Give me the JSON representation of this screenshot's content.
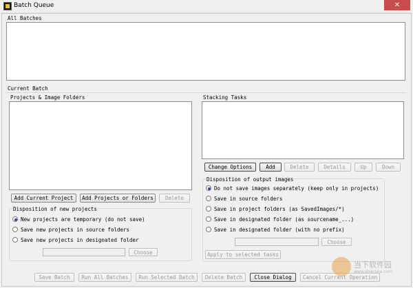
{
  "window": {
    "title": "Batch Queue",
    "close_glyph": "✕",
    "accent": "#c94c4c"
  },
  "all_batches": {
    "label": "All Batches"
  },
  "current_batch": {
    "label": "Current Batch"
  },
  "projects": {
    "label": "Projects & Image Folders",
    "buttons": {
      "add_current": "Add Current Project",
      "add_projects": "Add Projects or Folders",
      "delete": "Delete"
    },
    "disposition": {
      "label": "Disposition of new projects",
      "options": [
        "New projects are temporary (do not save)",
        "Save new projects in source folders",
        "Save new projects in designated folder"
      ],
      "selected_index": 0,
      "choose": "Choose"
    }
  },
  "stacking": {
    "label": "Stacking Tasks",
    "buttons": {
      "change_options": "Change Options",
      "add": "Add",
      "delete": "Delete",
      "details": "Details",
      "up": "Up",
      "down": "Down"
    },
    "output": {
      "label": "Disposition of output images",
      "options": [
        "Do not save images separately (keep only in projects)",
        "Save in source folders",
        "Save in project folders (as SavedImages/*)",
        "Save in designated folder (as sourcename_...)",
        "Save in designated folder (with no prefix)"
      ],
      "selected_index": 0,
      "choose": "Choose",
      "apply": "Apply to selected tasks"
    }
  },
  "footer": {
    "save_batch": "Save Batch",
    "run_all": "Run All Batches",
    "run_selected": "Run Selected Batch",
    "delete_batch": "Delete Batch",
    "close_dialog": "Close Dialog",
    "cancel_op": "Cancel Current Operation"
  },
  "watermark": {
    "text": "当下软件园",
    "sub": "www.downxia.com"
  }
}
